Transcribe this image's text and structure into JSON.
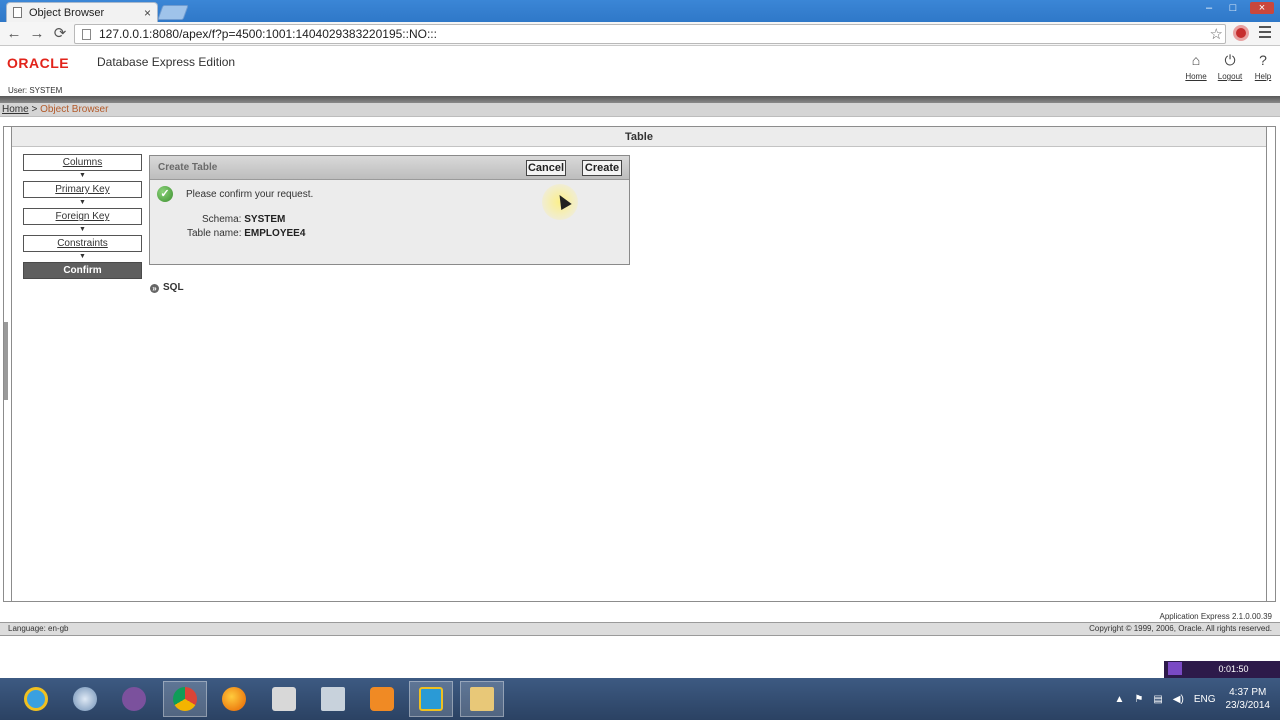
{
  "browser": {
    "tab_title": "Object Browser",
    "tab_close": "×",
    "url": "127.0.0.1:8080/apex/f?p=4500:1001:1404029383220195::NO:::",
    "window_controls": {
      "minimize": "–",
      "maximize": "□",
      "close": "×"
    },
    "back": "←",
    "forward": "→",
    "reload": "⟳",
    "bookmark_star": "☆"
  },
  "app": {
    "logo": "ORACLE",
    "product": "Database Express Edition",
    "user_label": "User: SYSTEM",
    "header_links": [
      {
        "label": "Home",
        "icon": "home-icon"
      },
      {
        "label": "Logout",
        "icon": "power-icon"
      },
      {
        "label": "Help",
        "icon": "help-icon"
      }
    ],
    "header_icon_glyphs": {
      "home": "⌂",
      "logout": "⏻",
      "help": "?"
    }
  },
  "breadcrumb": {
    "home": "Home",
    "separator": " > ",
    "current": "Object Browser"
  },
  "region": {
    "title": "Table"
  },
  "wizard": {
    "steps": [
      "Columns",
      "Primary Key",
      "Foreign Key",
      "Constraints",
      "Confirm"
    ],
    "current_step": "Confirm",
    "arrow": "▼"
  },
  "confirm": {
    "title": "Create Table",
    "cancel_label": "Cancel",
    "create_label": "Create",
    "message": "Please confirm your request.",
    "check_glyph": "✓",
    "schema_label": "Schema:",
    "schema_value": "SYSTEM",
    "table_label": "Table name:",
    "table_value": "EMPLOYEE4"
  },
  "sql_toggle": {
    "label": "SQL",
    "icon_glyph": "»"
  },
  "footer": {
    "version": "Application Express 2.1.0.00.39",
    "language": "Language: en-gb",
    "copyright": "Copyright © 1999, 2006, Oracle. All rights reserved."
  },
  "recorder": {
    "time": "0:01:50"
  },
  "taskbar": {
    "apps": [
      "internet-explorer",
      "safari",
      "viber",
      "chrome",
      "firefox",
      "chess",
      "sql-developer",
      "media-player",
      "skype-shortcut",
      "file-explorer"
    ],
    "active_app": "chrome",
    "language": "ENG",
    "time": "4:37 PM",
    "date": "23/3/2014",
    "tray_arrow": "▲"
  },
  "colors": {
    "oracle_red": "#e2231a",
    "crumb_current": "#b35a2a",
    "wizard_current": "#5f5f5f",
    "taskbar": "#2f4a6e"
  }
}
